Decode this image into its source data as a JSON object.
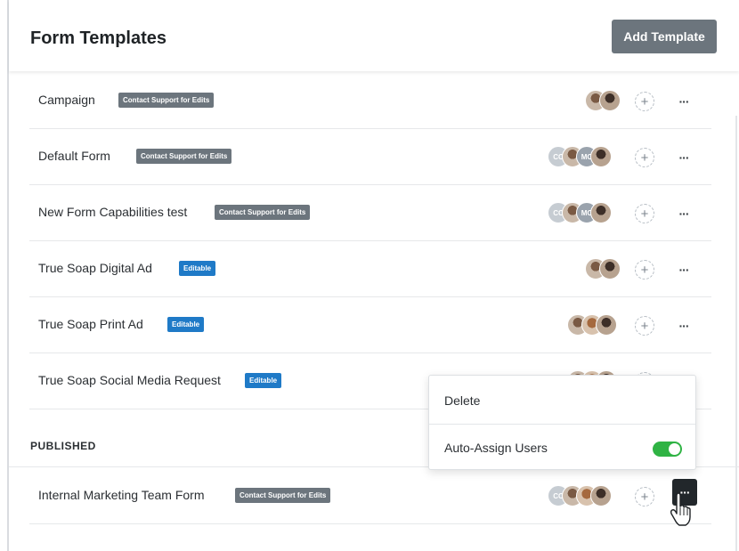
{
  "header": {
    "title": "Form Templates",
    "add_button": "Add Template"
  },
  "rows": [
    {
      "name": "Campaign",
      "badge": "Contact Support for Edits"
    },
    {
      "name": "Default Form",
      "badge": "Contact Support for Edits",
      "initials": [
        "CC",
        "MC"
      ]
    },
    {
      "name": "New Form Capabilities test",
      "badge": "Contact Support for Edits",
      "initials": [
        "CC",
        "MC"
      ]
    },
    {
      "name": "True Soap Digital Ad",
      "badge": "Editable"
    },
    {
      "name": "True Soap Print Ad",
      "badge": "Editable"
    },
    {
      "name": "True Soap Social Media Request",
      "badge": "Editable"
    }
  ],
  "published": {
    "label": "PUBLISHED",
    "rows": [
      {
        "name": "Internal Marketing Team Form",
        "badge": "Contact Support for Edits",
        "initials": [
          "CC"
        ]
      }
    ]
  },
  "menu": {
    "delete": "Delete",
    "auto_assign": "Auto-Assign Users",
    "auto_assign_enabled": true
  },
  "icons": {
    "add_user": "plus-circle-icon",
    "more": "more-horizontal-icon",
    "cursor": "hand-pointer-icon"
  },
  "colors": {
    "gray_badge": "#6c757d",
    "blue_badge": "#1f7ac7",
    "toggle_on": "#2fb344",
    "primary_button": "#6c757d"
  },
  "more_glyph": "···",
  "plus_glyph": "+"
}
